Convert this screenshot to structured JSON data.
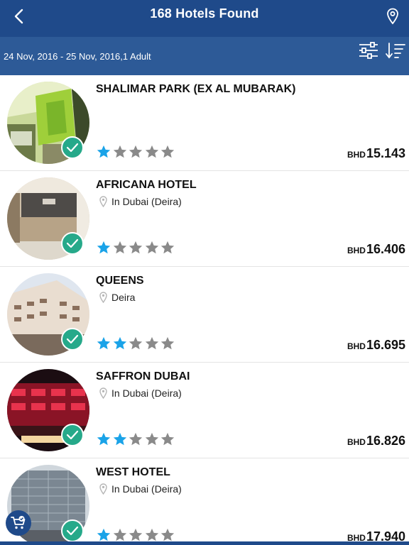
{
  "header": {
    "title": "168 Hotels Found",
    "back_icon": "chevron-left-icon",
    "map_icon": "location-pin-icon"
  },
  "subheader": {
    "date_range": "24 Nov, 2016 - 25 Nov, 2016,1 Adult",
    "filter_icon": "filter-sliders-icon",
    "sort_icon": "sort-icon"
  },
  "colors": {
    "header_bg": "#1f4a8a",
    "subheader_bg": "#2d5a97",
    "star_active": "#1aa3e8",
    "star_inactive": "#8a8a8a",
    "check_badge": "#26a98a"
  },
  "hotels": [
    {
      "name": "SHALIMAR PARK (EX AL MUBARAK)",
      "location": "",
      "stars": 1,
      "currency": "BHD",
      "price": "15.143"
    },
    {
      "name": "AFRICANA HOTEL",
      "location": "In Dubai (Deira)",
      "stars": 1,
      "currency": "BHD",
      "price": "16.406"
    },
    {
      "name": "QUEENS",
      "location": "Deira",
      "stars": 2,
      "currency": "BHD",
      "price": "16.695"
    },
    {
      "name": "SAFFRON DUBAI",
      "location": "In Dubai (Deira)",
      "stars": 2,
      "currency": "BHD",
      "price": "16.826"
    },
    {
      "name": "WEST HOTEL",
      "location": "In Dubai (Deira)",
      "stars": 1,
      "currency": "BHD",
      "price": "17.940"
    }
  ],
  "cart": {
    "icon": "cart-icon"
  }
}
